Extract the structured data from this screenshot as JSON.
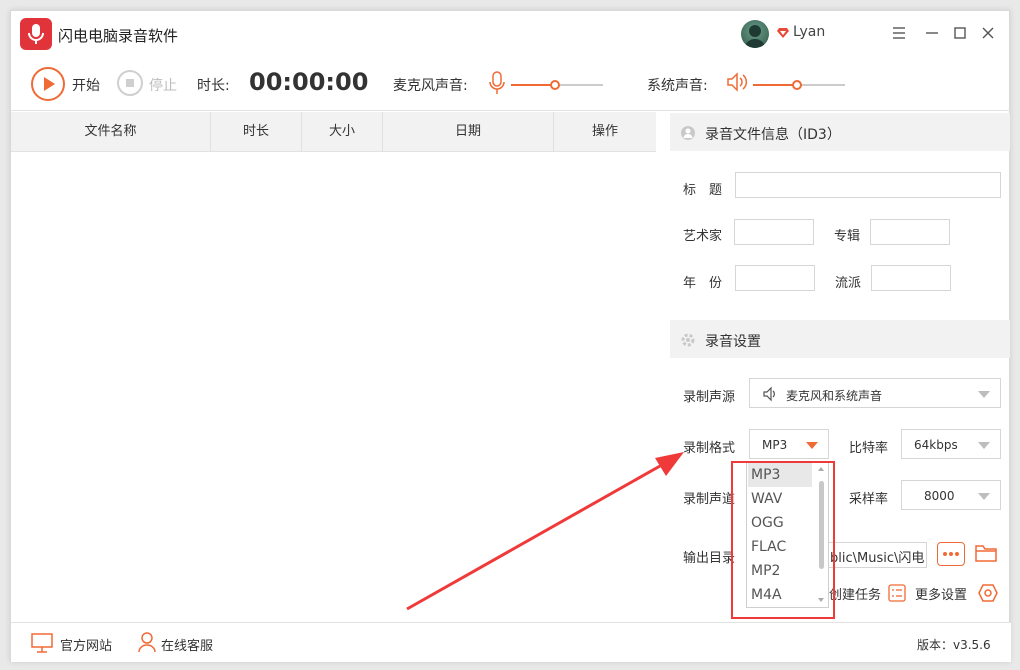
{
  "app": {
    "title": "闪电电脑录音软件",
    "username": "Lyan"
  },
  "toolbar": {
    "start_label": "开始",
    "stop_label": "停止",
    "duration_label": "时长:",
    "duration_value": "00:00:00",
    "mic_label": "麦克风声音:",
    "mic_level": 0.48,
    "system_label": "系统声音:",
    "system_level": 0.48
  },
  "table": {
    "columns": [
      "文件名称",
      "时长",
      "大小",
      "日期",
      "操作"
    ]
  },
  "id3": {
    "section_title": "录音文件信息（ID3）",
    "title_label": "标　题",
    "artist_label": "艺术家",
    "album_label": "专辑",
    "year_label": "年　份",
    "genre_label": "流派"
  },
  "settings": {
    "section_title": "录音设置",
    "source_label": "录制声源",
    "source_value": "麦克风和系统声音",
    "format_label": "录制格式",
    "format_value": "MP3",
    "bitrate_label": "比特率",
    "bitrate_value": "64kbps",
    "channel_label": "录制声道",
    "samplerate_label": "采样率",
    "samplerate_value": "8000",
    "output_label": "输出目录",
    "output_value": "blic\\Music\\闪电",
    "task_label": "创建任务",
    "more_label": "更多设置"
  },
  "format_options": [
    "MP3",
    "WAV",
    "OGG",
    "FLAC",
    "MP2",
    "M4A"
  ],
  "footer": {
    "website": "官方网站",
    "service": "在线客服",
    "version": "版本：v3.5.6"
  },
  "colors": {
    "accent": "#f06a35",
    "logo": "#e0333a",
    "annotation": "#f03a3a"
  }
}
